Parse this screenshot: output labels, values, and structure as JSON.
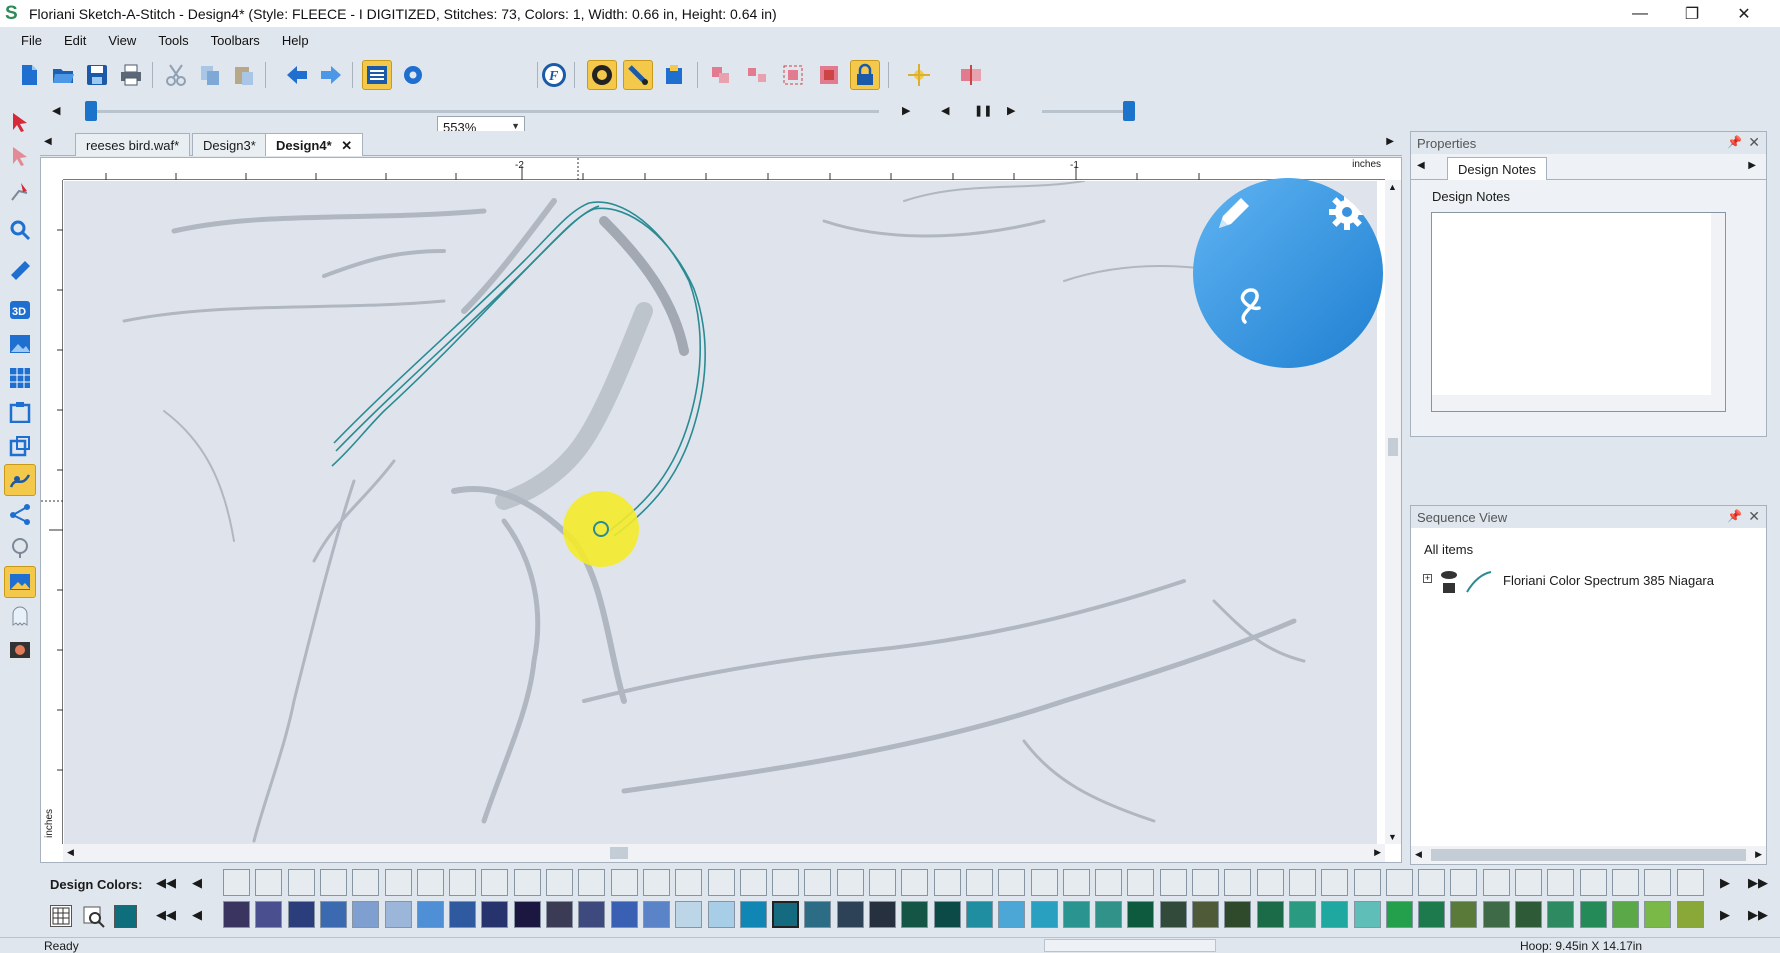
{
  "window": {
    "title": "Floriani Sketch-A-Stitch - Design4* (Style: FLEECE - I DIGITIZED, Stitches: 73, Colors: 1, Width: 0.66 in, Height: 0.64 in)",
    "minimize": "—",
    "restore": "❐",
    "close": "✕"
  },
  "menu": [
    "File",
    "Edit",
    "View",
    "Tools",
    "Toolbars",
    "Help"
  ],
  "toolbar": {
    "zoom_value": "553%"
  },
  "tabs": [
    "reeses bird.waf*",
    "Design3*",
    "Design4*"
  ],
  "tab_close": "✕",
  "ruler": {
    "units_top": "inches",
    "units_left": "inches",
    "tick_labels": [
      "-2",
      "-1"
    ]
  },
  "properties": {
    "title": "Properties",
    "tab": "Design Notes",
    "notes_label": "Design Notes",
    "notes_value": ""
  },
  "sequence": {
    "title": "Sequence View",
    "root": "All items",
    "item": "Floriani Color Spectrum 385 Niagara"
  },
  "palette": {
    "label": "Design Colors:",
    "colors": [
      "#3a3560",
      "#4a4f8f",
      "#2c3d7c",
      "#3b6ab0",
      "#7e9fd0",
      "#9bb6d9",
      "#4f8fd6",
      "#2f5aa0",
      "#26336c",
      "#1c1740",
      "#3c3b55",
      "#3e4a7e",
      "#3a60b4",
      "#5b84c8",
      "#bcd6e8",
      "#a8cde6",
      "#0f86b3",
      "#146a7e",
      "#2c6c85",
      "#2d4256",
      "#26303f",
      "#155545",
      "#0c4a48",
      "#1e8ea0",
      "#4ca6d6",
      "#2aa0c0",
      "#2a9490",
      "#31928a",
      "#0d5a3e",
      "#314a3a",
      "#4f5a38",
      "#2f4a2a",
      "#1b6a48",
      "#2a9a80",
      "#1fa8a0",
      "#5fbfb8",
      "#24a04c",
      "#1c7a4c",
      "#5a7a3a",
      "#3f6a48",
      "#2f5a38",
      "#2e8a60",
      "#238a58",
      "#5aa848",
      "#7ab848",
      "#8aa838"
    ]
  },
  "status": {
    "left": "Ready",
    "right": "Hoop: 9.45in X 14.17in"
  }
}
